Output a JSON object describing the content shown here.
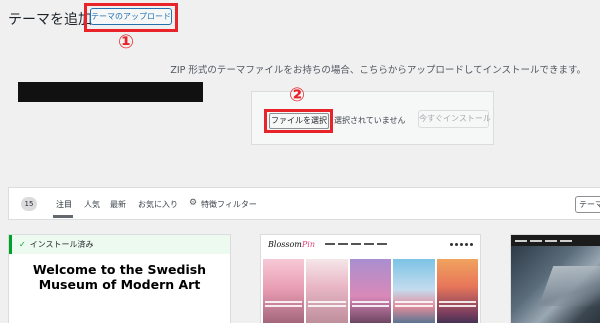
{
  "header": {
    "title": "テーマを追加",
    "upload_button": "テーマのアップロード"
  },
  "markers": {
    "step1": "①",
    "step2": "②"
  },
  "upload": {
    "description": "ZIP 形式のテーマファイルをお持ちの場合、こちらからアップロードしてインストールできます。",
    "file_button": "ファイルを選択",
    "no_file_text": "選択されていません",
    "install_button": "今すぐインストール"
  },
  "filter_bar": {
    "count": "15",
    "tabs": [
      "注目",
      "人気",
      "最新",
      "お気に入り"
    ],
    "feature_filter": "特徴フィルター",
    "search_value": "テーマ"
  },
  "themes": [
    {
      "installed_label": "インストール済み",
      "preview_title": "Welcome to the Swedish Museum of Modern Art"
    },
    {
      "logo_main": "Blossom",
      "logo_accent": "Pin"
    },
    {}
  ],
  "colors": {
    "highlight": "#e8242a",
    "wp_blue": "#2271b1",
    "installed_green": "#00a32a"
  }
}
